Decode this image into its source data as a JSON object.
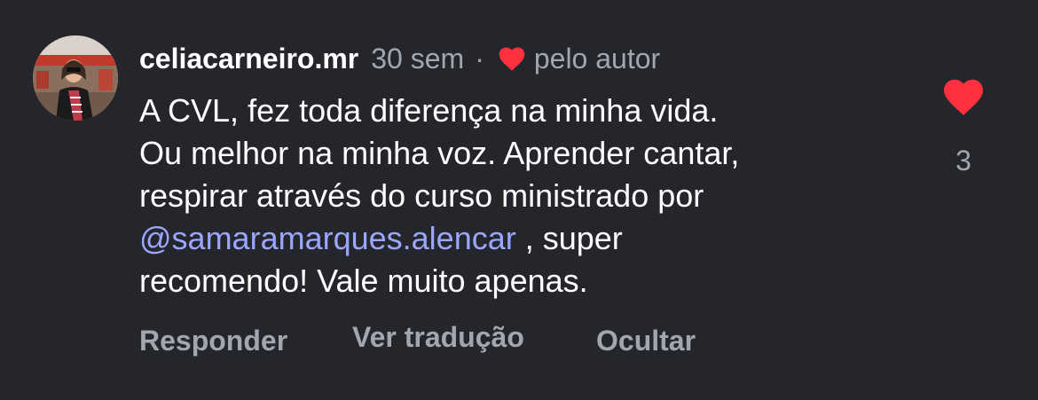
{
  "comment": {
    "username": "celiacarneiro.mr",
    "time": "30 sem",
    "separator": "·",
    "liked_by_author_label": "pelo autor",
    "avatar_icon": "user-avatar-photo",
    "text_lines": {
      "line1": "A CVL, fez toda diferença na minha vida.",
      "line2": "Ou melhor na minha voz. Aprender cantar,",
      "line3": "respirar através do curso ministrado por",
      "mention": "@samaramarques.alencar",
      "line4_rest": " , super",
      "line5": "recomendo! Vale muito apenas."
    },
    "like": {
      "icon": "heart-filled-icon",
      "count": "3",
      "liked": true
    },
    "actions": {
      "reply": "Responder",
      "translate": "Ver tradução",
      "hide": "Ocultar"
    }
  },
  "colors": {
    "background": "#25262c",
    "text": "#ffffff",
    "secondary": "#a3a6ad",
    "mention": "#9ba6ff",
    "heart": "#ff3040"
  }
}
